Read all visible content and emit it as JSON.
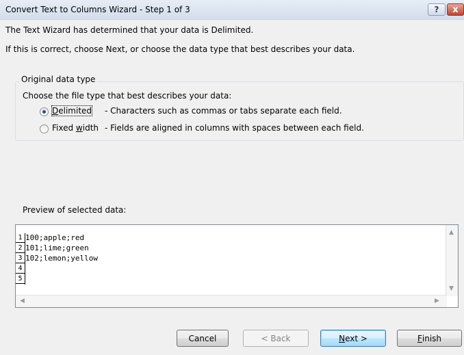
{
  "window": {
    "title": "Convert Text to Columns Wizard - Step 1 of 3",
    "help_label": "?",
    "close_label": "x"
  },
  "intro": {
    "line1": "The Text Wizard has determined that your data is Delimited.",
    "line2": "If this is correct, choose Next, or choose the data type that best describes your data."
  },
  "original_data_type": {
    "legend": "Original data type",
    "prompt": "Choose the file type that best describes your data:",
    "options": [
      {
        "label_pre": "",
        "label_u": "D",
        "label_post": "elimited",
        "description": "- Characters such as commas or tabs separate each field.",
        "selected": true
      },
      {
        "label_pre": "Fixed ",
        "label_u": "w",
        "label_post": "idth",
        "description": "- Fields are aligned in columns with spaces between each field.",
        "selected": false
      }
    ]
  },
  "preview": {
    "label": "Preview of selected data:",
    "rows": [
      {
        "num": "1",
        "text": "100;apple;red"
      },
      {
        "num": "2",
        "text": "101;lime;green"
      },
      {
        "num": "3",
        "text": "102;lemon;yellow"
      },
      {
        "num": "4",
        "text": ""
      },
      {
        "num": "5",
        "text": ""
      }
    ]
  },
  "buttons": {
    "cancel": {
      "label": "Cancel"
    },
    "back": {
      "label": "< Back"
    },
    "next": {
      "u": "N",
      "rest": "ext >"
    },
    "finish": {
      "u": "F",
      "rest": "inish"
    }
  }
}
